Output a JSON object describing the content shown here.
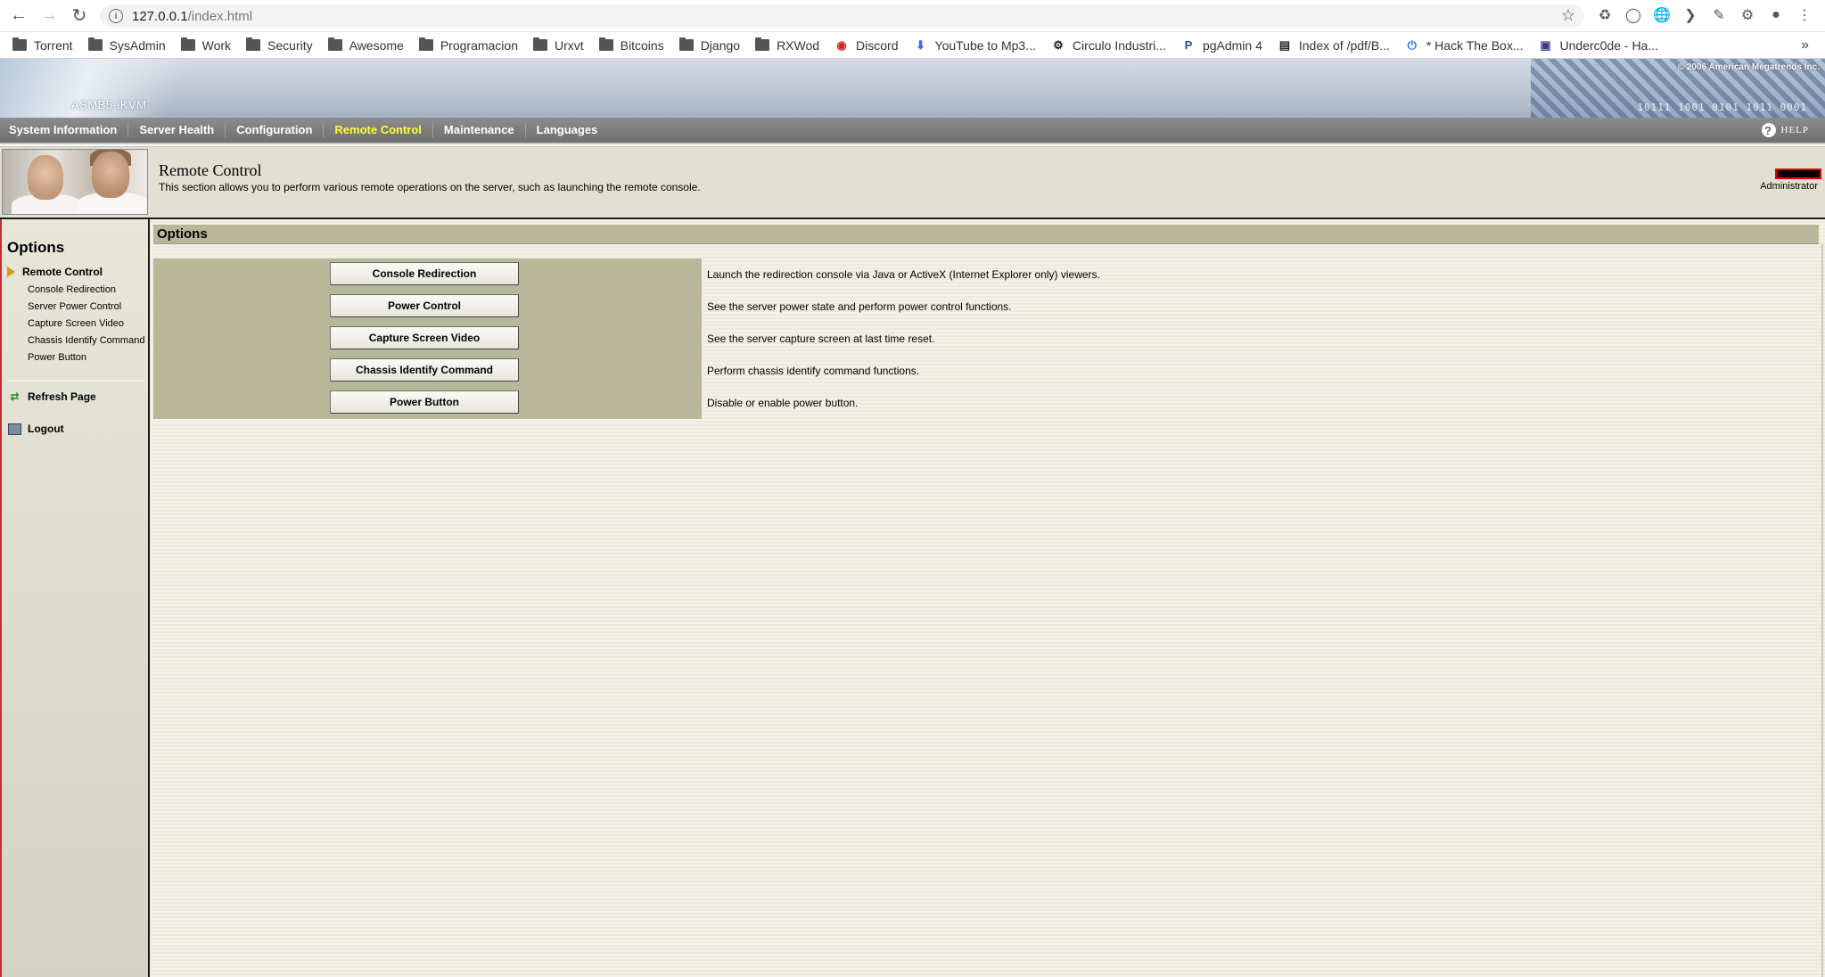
{
  "browser": {
    "url_host": "127.0.0.1",
    "url_path": "/index.html",
    "bookmarks": [
      {
        "label": "Torrent",
        "icon": "folder-icon"
      },
      {
        "label": "SysAdmin",
        "icon": "folder-icon"
      },
      {
        "label": "Work",
        "icon": "folder-icon"
      },
      {
        "label": "Security",
        "icon": "folder-icon"
      },
      {
        "label": "Awesome",
        "icon": "folder-icon"
      },
      {
        "label": "Programacion",
        "icon": "folder-icon"
      },
      {
        "label": "Urxvt",
        "icon": "folder-icon"
      },
      {
        "label": "Bitcoins",
        "icon": "folder-icon"
      },
      {
        "label": "Django",
        "icon": "folder-icon"
      },
      {
        "label": "RXWod",
        "icon": "folder-icon"
      },
      {
        "label": "Discord",
        "icon": "discord-icon"
      },
      {
        "label": "YouTube to Mp3...",
        "icon": "download-icon"
      },
      {
        "label": "Circulo Industri...",
        "icon": "gear-icon"
      },
      {
        "label": "pgAdmin 4",
        "icon": "pgadmin-icon"
      },
      {
        "label": "Index of /pdf/B...",
        "icon": "page-icon"
      },
      {
        "label": "* Hack The Box...",
        "icon": "power-icon"
      },
      {
        "label": "Underc0de - Ha...",
        "icon": "site-icon"
      }
    ]
  },
  "app": {
    "product": "ASMB5-iKVM",
    "copyright": "© 2006 American Megatrends Inc.",
    "binary_text": "10111 1001 0101 1011 0001",
    "help_label": "HELP"
  },
  "topnav": {
    "items": [
      {
        "label": "System Information"
      },
      {
        "label": "Server Health"
      },
      {
        "label": "Configuration"
      },
      {
        "label": "Remote Control"
      },
      {
        "label": "Maintenance"
      },
      {
        "label": "Languages"
      }
    ],
    "active": "Remote Control"
  },
  "header": {
    "title": "Remote Control",
    "description": "This section allows you to perform various remote operations on the server, such as launching the remote console.",
    "user_role": "Administrator"
  },
  "sidebar": {
    "title": "Options",
    "active_item": "Remote Control",
    "sub_items": [
      {
        "label": "Console Redirection"
      },
      {
        "label": "Server Power Control"
      },
      {
        "label": "Capture Screen Video"
      },
      {
        "label": "Chassis Identify Command"
      },
      {
        "label": "Power Button"
      }
    ],
    "refresh_label": "Refresh Page",
    "logout_label": "Logout"
  },
  "main": {
    "section_title": "Options",
    "rows": [
      {
        "button": "Console Redirection",
        "description": "Launch the redirection console via Java or ActiveX (Internet Explorer only) viewers."
      },
      {
        "button": "Power Control",
        "description": "See the server power state and perform power control functions."
      },
      {
        "button": "Capture Screen Video",
        "description": "See the server capture screen at last time reset."
      },
      {
        "button": "Chassis Identify Command",
        "description": "Perform chassis identify command functions."
      },
      {
        "button": "Power Button",
        "description": "Disable or enable power button."
      }
    ]
  },
  "colors": {
    "nav_active": "#ffff33",
    "options_bar": "#b8b79a",
    "header_bg": "#e2e0d2"
  }
}
